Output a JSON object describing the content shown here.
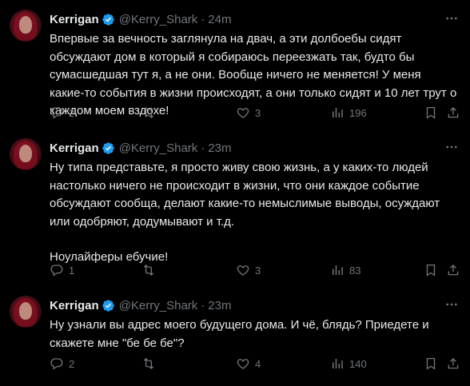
{
  "colors": {
    "background": "#000000",
    "text": "#e7e9ea",
    "muted": "#71767b",
    "verified": "#1d9bf0",
    "divider": "#2f3336"
  },
  "tweets": [
    {
      "name": "Kerrigan",
      "handle": "@Kerry_Shark",
      "dot": "·",
      "time": "24m",
      "paragraphs": [
        "Впервые за вечность заглянула на двач, а эти долбоебы сидят обсуждают дом в который я собираюсь переезжать так, будто бы сумасшедшая тут я, а не они. Вообще ничего не меняется! У меня какие-то события в жизни происходят, а они только сидят и 10 лет трут о каждом моем вздохе!"
      ],
      "replies": "2",
      "retweets": "",
      "likes": "3",
      "views": "196"
    },
    {
      "name": "Kerrigan",
      "handle": "@Kerry_Shark",
      "dot": "·",
      "time": "23m",
      "paragraphs": [
        "Ну типа представьте, я просто живу свою жизнь, а у каких-то людей настолько ничего не происходит в жизни, что они каждое событие обсуждают сообща, делают какие-то немыслимые выводы, осуждают или одобряют, додумывают и т.д.",
        "Ноулайферы ебучие!"
      ],
      "replies": "1",
      "retweets": "",
      "likes": "3",
      "views": "83"
    },
    {
      "name": "Kerrigan",
      "handle": "@Kerry_Shark",
      "dot": "·",
      "time": "23m",
      "paragraphs": [
        "Ну узнали вы адрес моего будущего дома. И чё, блядь? Приедете и скажете мне \"бе бе бе\"?"
      ],
      "replies": "2",
      "retweets": "",
      "likes": "4",
      "views": "140"
    }
  ],
  "icons": {
    "avatar": "profile-photo",
    "verified": "verified-badge-icon",
    "more": "more-dots-icon",
    "reply": "reply-bubble-icon",
    "retweet": "retweet-arrows-icon",
    "like": "heart-icon",
    "views": "views-bar-chart-icon",
    "bookmark": "bookmark-icon",
    "share": "share-upload-icon"
  }
}
